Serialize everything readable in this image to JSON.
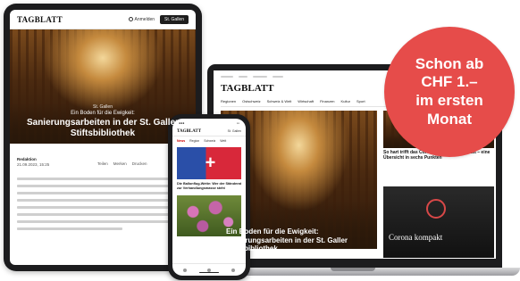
{
  "tablet": {
    "logo": "TAGBLATT",
    "login_label": "Anmelden",
    "edition_label": "St. Gallen",
    "hero_kicker": "St. Gallen",
    "hero_subtitle": "Ein Boden für die Ewigkeit:",
    "hero_title": "Sanierungsarbeiten in der St. Galler Stiftsbibliothek",
    "meta_author": "Redaktion",
    "meta_date": "21.09.2023, 15:25",
    "share": [
      "Teilen",
      "Merken",
      "Drucken"
    ]
  },
  "laptop": {
    "logo": "TAGBLATT",
    "nav": [
      "Regionen",
      "Ostschweiz",
      "Schweiz & Welt",
      "Wirtschaft",
      "Finanzen",
      "Kultur",
      "Sport"
    ],
    "hero_title": "Ein Boden für die Ewigkeit: Sanierungsarbeiten in der St. Galler Stiftsbibliothek",
    "side_title": "So hart trifft das Coronavirus die Wirtschaft – eine Übersicht in sechs Punkten",
    "dark_title": "Corona kompakt"
  },
  "phone": {
    "logo": "TAGBLATT",
    "edition_label": "St. Gallen",
    "tabs": [
      "News",
      "Region",
      "Schweiz",
      "Welt"
    ],
    "article_title": "Die Ballonflug-Wette: Wer der Ständerat zur Verhandlungsmasse steht"
  },
  "badge": {
    "lines": [
      "Schon ab",
      "CHF 1.–",
      "im ersten",
      "Monat"
    ],
    "color": "#e64c4a"
  },
  "colors": {
    "device_frame": "#1c1c1e",
    "accent_red": "#e64c4a"
  }
}
